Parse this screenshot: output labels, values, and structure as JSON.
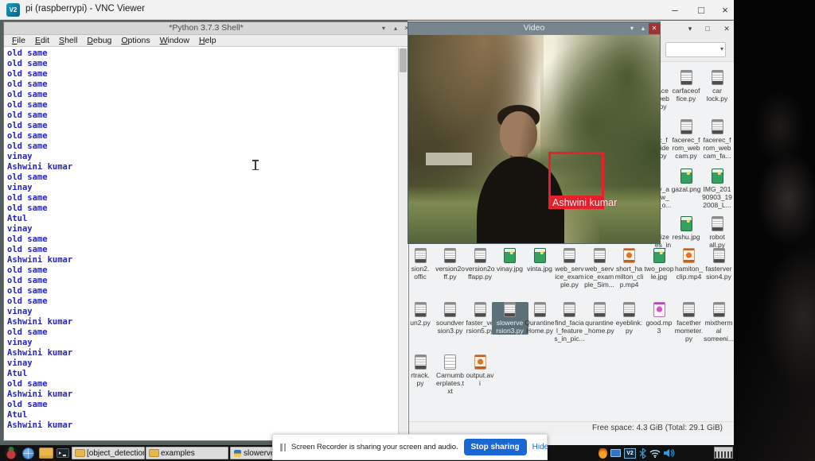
{
  "vnc": {
    "logo_text": "V2",
    "title": "pi (raspberrypi) - VNC Viewer"
  },
  "glyphs": {
    "minimize": "–",
    "maximize": "□",
    "close": "×",
    "shade": "▾",
    "unshade": "▴",
    "x": "✕",
    "dropdown": "▾"
  },
  "shell": {
    "title": "*Python 3.7.3 Shell*",
    "menus": [
      "File",
      "Edit",
      "Shell",
      "Debug",
      "Options",
      "Window",
      "Help"
    ],
    "lines": [
      "old same",
      "old same",
      "old same",
      "old same",
      "old same",
      "old same",
      "old same",
      "old same",
      "old same",
      "old same",
      "vinay",
      "Ashwini kumar",
      "old same",
      "vinay",
      "old same",
      "old same",
      "Atul",
      "vinay",
      "old same",
      "old same",
      "Ashwini kumar",
      "old same",
      "old same",
      "old same",
      "old same",
      "vinay",
      "Ashwini kumar",
      "old same",
      "vinay",
      "Ashwini kumar",
      "vinay",
      "Atul",
      "old same",
      "Ashwini kumar",
      "old same",
      "Atul",
      "Ashwini kumar"
    ],
    "text_color": "#2323c8"
  },
  "video": {
    "title": "Video",
    "detection_label": "Ashwini kumar",
    "box_color": "#e8202a"
  },
  "filemanager": {
    "status": "Free space: 4.3 GiB (Total: 29.1 GiB)",
    "right_rows": [
      [
        {
          "label": "ace\nweb\npy",
          "type": "none"
        },
        {
          "label": "carfaceof\nfice.py",
          "type": "py"
        },
        {
          "label": "car\nlock.py",
          "type": "py"
        }
      ],
      [
        {
          "label": "c_f\nvide\npy",
          "type": "none"
        },
        {
          "label": "facerec_f\nrom_web\ncam.py",
          "type": "py"
        },
        {
          "label": "facerec_f\nrom_web\ncam_fa...",
          "type": "py"
        }
      ],
      [
        {
          "label": "fy_a\naw_\ns_o...",
          "type": "none"
        },
        {
          "label": "gazal.png",
          "type": "img"
        },
        {
          "label": "IMG_201\n90903_19\n2008_L...",
          "type": "img"
        }
      ],
      [
        {
          "label": "nize\nes_in",
          "type": "none"
        },
        {
          "label": "reshu.jpg",
          "type": "img"
        },
        {
          "label": "robot\nall.py",
          "type": "py"
        }
      ]
    ],
    "main_rows": [
      [
        {
          "label": "sion2.\noffic",
          "type": "py"
        },
        {
          "label": "version2o\nff.py",
          "type": "py"
        },
        {
          "label": "version2o\nffapp.py",
          "type": "py"
        },
        {
          "label": "vinay.jpg",
          "type": "img"
        },
        {
          "label": "vinta.jpg",
          "type": "img"
        },
        {
          "label": "web_serv\nice_exam\nple.py",
          "type": "py"
        },
        {
          "label": "web_serv\nice_exam\nple_Sim...",
          "type": "py"
        },
        {
          "label": "short_ha\nmilton_cli\np.mp4",
          "type": "vid"
        },
        {
          "label": "two_peop\nle.jpg",
          "type": "img"
        },
        {
          "label": "hamiton_\nclip.mp4",
          "type": "vid"
        },
        {
          "label": "fasterver\nsion4.py",
          "type": "py"
        }
      ],
      [
        {
          "label": "un2.py",
          "type": "py"
        },
        {
          "label": "soundver\nsion3.py",
          "type": "py"
        },
        {
          "label": "faster_ve\nrsion5.py",
          "type": "py"
        },
        {
          "label": "slowerve\nrsion3.py",
          "type": "py",
          "selected": true
        },
        {
          "label": "Qurantine\nHome.py",
          "type": "py"
        },
        {
          "label": "find_facia\nl_feature\ns_in_pic...",
          "type": "py"
        },
        {
          "label": "qurantine\n_home.py",
          "type": "py"
        },
        {
          "label": "eyeblink.\npy",
          "type": "py"
        },
        {
          "label": "good.mp\n3",
          "type": "aud"
        },
        {
          "label": "facether\nmometer.\npy",
          "type": "py"
        },
        {
          "label": "mixtherm\nal\nsorreeni...",
          "type": "py"
        }
      ],
      [
        {
          "label": "rtrack.\npy",
          "type": "py"
        },
        {
          "label": "Carnumb\nerplates.t\nxt",
          "type": "txt"
        },
        {
          "label": "output.av\ni",
          "type": "vid"
        }
      ]
    ]
  },
  "taskbar": {
    "buttons": [
      {
        "label": "[object_detection]",
        "icon": "folder"
      },
      {
        "label": "examples",
        "icon": "folder"
      },
      {
        "label": "slowerversio",
        "icon": "python"
      }
    ],
    "vnc_badge": "V2"
  },
  "recorder": {
    "message": "Screen Recorder is sharing your screen and audio.",
    "stop_label": "Stop sharing",
    "hide_label": "Hide"
  }
}
